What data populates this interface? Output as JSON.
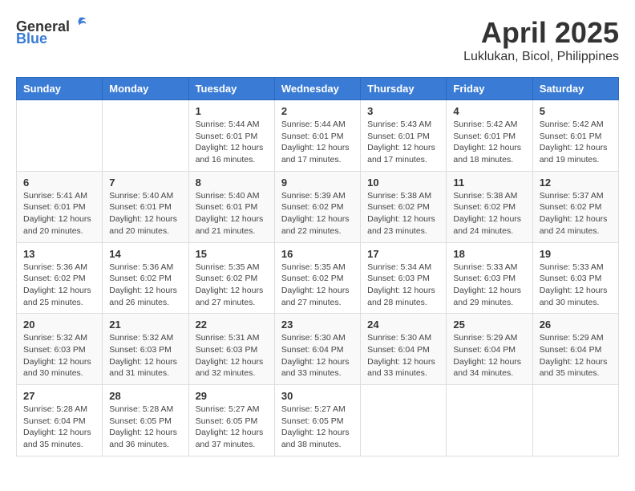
{
  "header": {
    "logo_general": "General",
    "logo_blue": "Blue",
    "title": "April 2025",
    "subtitle": "Luklukan, Bicol, Philippines"
  },
  "calendar": {
    "days_of_week": [
      "Sunday",
      "Monday",
      "Tuesday",
      "Wednesday",
      "Thursday",
      "Friday",
      "Saturday"
    ],
    "weeks": [
      [
        {
          "day": "",
          "content": ""
        },
        {
          "day": "",
          "content": ""
        },
        {
          "day": "1",
          "content": "Sunrise: 5:44 AM\nSunset: 6:01 PM\nDaylight: 12 hours and 16 minutes."
        },
        {
          "day": "2",
          "content": "Sunrise: 5:44 AM\nSunset: 6:01 PM\nDaylight: 12 hours and 17 minutes."
        },
        {
          "day": "3",
          "content": "Sunrise: 5:43 AM\nSunset: 6:01 PM\nDaylight: 12 hours and 17 minutes."
        },
        {
          "day": "4",
          "content": "Sunrise: 5:42 AM\nSunset: 6:01 PM\nDaylight: 12 hours and 18 minutes."
        },
        {
          "day": "5",
          "content": "Sunrise: 5:42 AM\nSunset: 6:01 PM\nDaylight: 12 hours and 19 minutes."
        }
      ],
      [
        {
          "day": "6",
          "content": "Sunrise: 5:41 AM\nSunset: 6:01 PM\nDaylight: 12 hours and 20 minutes."
        },
        {
          "day": "7",
          "content": "Sunrise: 5:40 AM\nSunset: 6:01 PM\nDaylight: 12 hours and 20 minutes."
        },
        {
          "day": "8",
          "content": "Sunrise: 5:40 AM\nSunset: 6:01 PM\nDaylight: 12 hours and 21 minutes."
        },
        {
          "day": "9",
          "content": "Sunrise: 5:39 AM\nSunset: 6:02 PM\nDaylight: 12 hours and 22 minutes."
        },
        {
          "day": "10",
          "content": "Sunrise: 5:38 AM\nSunset: 6:02 PM\nDaylight: 12 hours and 23 minutes."
        },
        {
          "day": "11",
          "content": "Sunrise: 5:38 AM\nSunset: 6:02 PM\nDaylight: 12 hours and 24 minutes."
        },
        {
          "day": "12",
          "content": "Sunrise: 5:37 AM\nSunset: 6:02 PM\nDaylight: 12 hours and 24 minutes."
        }
      ],
      [
        {
          "day": "13",
          "content": "Sunrise: 5:36 AM\nSunset: 6:02 PM\nDaylight: 12 hours and 25 minutes."
        },
        {
          "day": "14",
          "content": "Sunrise: 5:36 AM\nSunset: 6:02 PM\nDaylight: 12 hours and 26 minutes."
        },
        {
          "day": "15",
          "content": "Sunrise: 5:35 AM\nSunset: 6:02 PM\nDaylight: 12 hours and 27 minutes."
        },
        {
          "day": "16",
          "content": "Sunrise: 5:35 AM\nSunset: 6:02 PM\nDaylight: 12 hours and 27 minutes."
        },
        {
          "day": "17",
          "content": "Sunrise: 5:34 AM\nSunset: 6:03 PM\nDaylight: 12 hours and 28 minutes."
        },
        {
          "day": "18",
          "content": "Sunrise: 5:33 AM\nSunset: 6:03 PM\nDaylight: 12 hours and 29 minutes."
        },
        {
          "day": "19",
          "content": "Sunrise: 5:33 AM\nSunset: 6:03 PM\nDaylight: 12 hours and 30 minutes."
        }
      ],
      [
        {
          "day": "20",
          "content": "Sunrise: 5:32 AM\nSunset: 6:03 PM\nDaylight: 12 hours and 30 minutes."
        },
        {
          "day": "21",
          "content": "Sunrise: 5:32 AM\nSunset: 6:03 PM\nDaylight: 12 hours and 31 minutes."
        },
        {
          "day": "22",
          "content": "Sunrise: 5:31 AM\nSunset: 6:03 PM\nDaylight: 12 hours and 32 minutes."
        },
        {
          "day": "23",
          "content": "Sunrise: 5:30 AM\nSunset: 6:04 PM\nDaylight: 12 hours and 33 minutes."
        },
        {
          "day": "24",
          "content": "Sunrise: 5:30 AM\nSunset: 6:04 PM\nDaylight: 12 hours and 33 minutes."
        },
        {
          "day": "25",
          "content": "Sunrise: 5:29 AM\nSunset: 6:04 PM\nDaylight: 12 hours and 34 minutes."
        },
        {
          "day": "26",
          "content": "Sunrise: 5:29 AM\nSunset: 6:04 PM\nDaylight: 12 hours and 35 minutes."
        }
      ],
      [
        {
          "day": "27",
          "content": "Sunrise: 5:28 AM\nSunset: 6:04 PM\nDaylight: 12 hours and 35 minutes."
        },
        {
          "day": "28",
          "content": "Sunrise: 5:28 AM\nSunset: 6:05 PM\nDaylight: 12 hours and 36 minutes."
        },
        {
          "day": "29",
          "content": "Sunrise: 5:27 AM\nSunset: 6:05 PM\nDaylight: 12 hours and 37 minutes."
        },
        {
          "day": "30",
          "content": "Sunrise: 5:27 AM\nSunset: 6:05 PM\nDaylight: 12 hours and 38 minutes."
        },
        {
          "day": "",
          "content": ""
        },
        {
          "day": "",
          "content": ""
        },
        {
          "day": "",
          "content": ""
        }
      ]
    ]
  }
}
